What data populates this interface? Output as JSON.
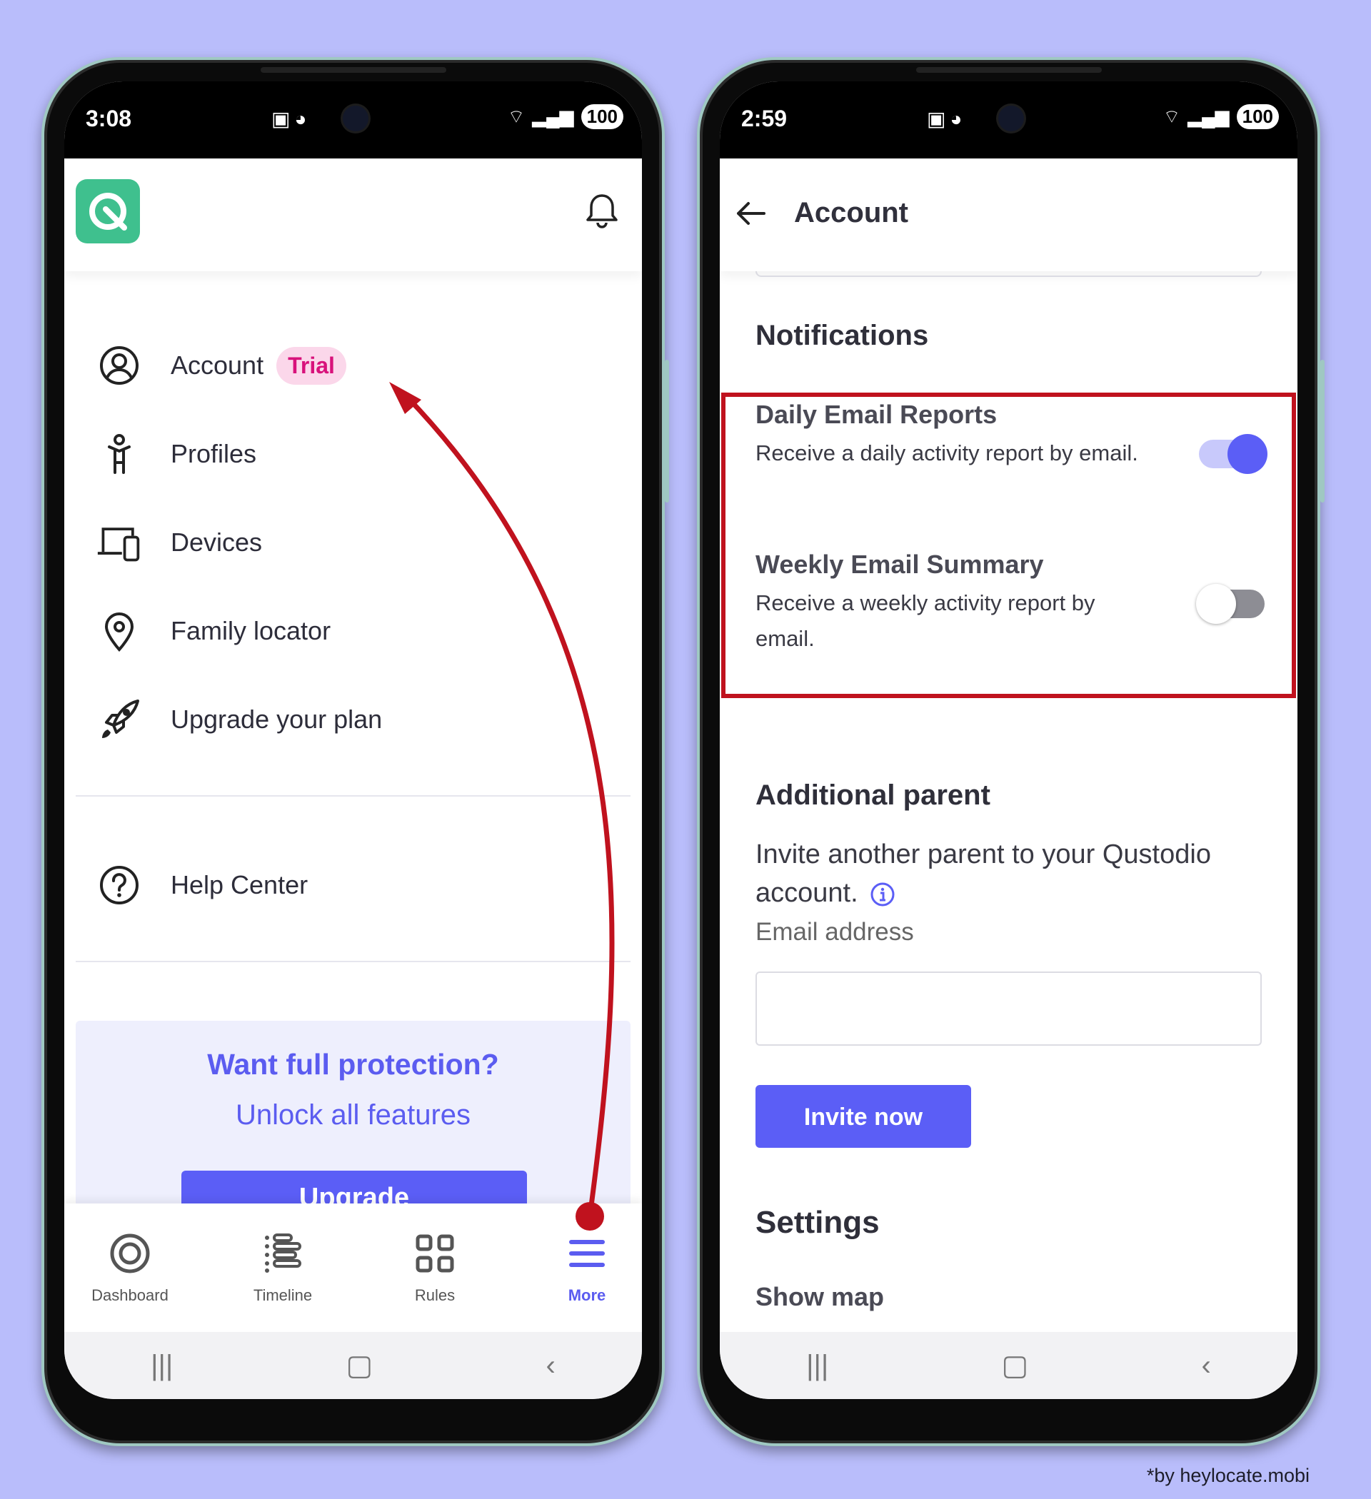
{
  "left_phone": {
    "status": {
      "time": "3:08",
      "battery": "100"
    },
    "menu": {
      "account": {
        "label": "Account",
        "badge": "Trial"
      },
      "profiles": "Profiles",
      "devices": "Devices",
      "family_locator": "Family locator",
      "upgrade_plan": "Upgrade your plan",
      "help_center": "Help Center"
    },
    "promo": {
      "title": "Want full protection?",
      "subtitle": "Unlock all features",
      "button": "Upgrade"
    },
    "bottom_nav": [
      {
        "label": "Dashboard",
        "icon": "target-icon"
      },
      {
        "label": "Timeline",
        "icon": "timeline-icon"
      },
      {
        "label": "Rules",
        "icon": "grid-icon"
      },
      {
        "label": "More",
        "icon": "menu-icon",
        "active": true
      }
    ]
  },
  "right_phone": {
    "status": {
      "time": "2:59",
      "battery": "100"
    },
    "header": {
      "title": "Account"
    },
    "notifications": {
      "heading": "Notifications",
      "daily": {
        "title": "Daily Email Reports",
        "desc": "Receive a daily activity report by email.",
        "enabled": true
      },
      "weekly": {
        "title": "Weekly Email Summary",
        "desc": "Receive a weekly activity report by email.",
        "enabled": false
      }
    },
    "additional_parent": {
      "heading": "Additional parent",
      "text": "Invite another parent to your Qustodio account.",
      "email_label": "Email address",
      "email_value": "",
      "invite_button": "Invite now"
    },
    "settings": {
      "heading": "Settings",
      "first_item": "Show map"
    }
  },
  "colors": {
    "accent": "#5b5ef6",
    "highlight_red": "#c0121e",
    "background": "#b9bdfb",
    "trial_pink": "#d8127b",
    "logo_green": "#3fc08e"
  },
  "credit": "*by heylocate.mobi"
}
